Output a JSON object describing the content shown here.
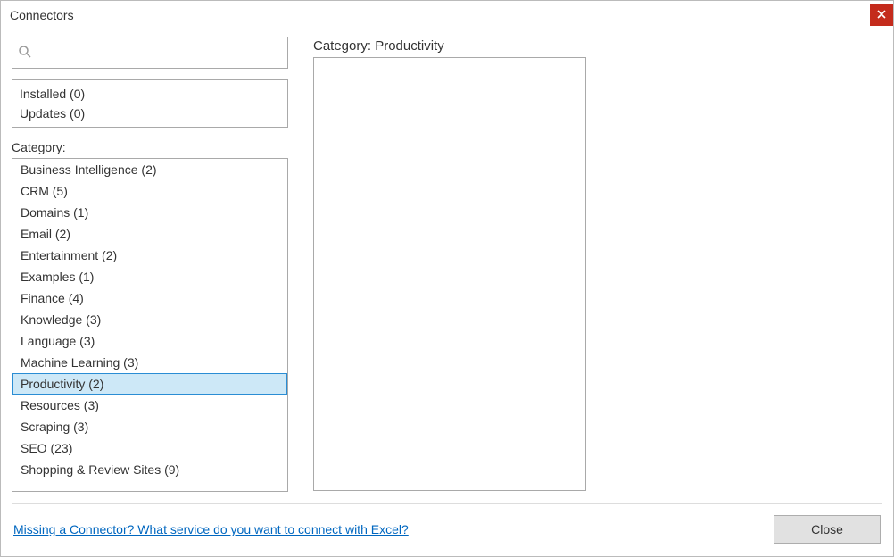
{
  "window": {
    "title": "Connectors"
  },
  "search": {
    "placeholder": ""
  },
  "status": {
    "installed_label": "Installed (0)",
    "updates_label": "Updates (0)"
  },
  "category_label": "Category:",
  "categories": [
    {
      "label": "Business Intelligence (2)",
      "selected": false
    },
    {
      "label": "CRM (5)",
      "selected": false
    },
    {
      "label": "Domains (1)",
      "selected": false
    },
    {
      "label": "Email (2)",
      "selected": false
    },
    {
      "label": "Entertainment (2)",
      "selected": false
    },
    {
      "label": "Examples (1)",
      "selected": false
    },
    {
      "label": "Finance (4)",
      "selected": false
    },
    {
      "label": "Knowledge (3)",
      "selected": false
    },
    {
      "label": "Language (3)",
      "selected": false
    },
    {
      "label": "Machine Learning (3)",
      "selected": false
    },
    {
      "label": "Productivity (2)",
      "selected": true
    },
    {
      "label": "Resources (3)",
      "selected": false
    },
    {
      "label": "Scraping (3)",
      "selected": false
    },
    {
      "label": "SEO (23)",
      "selected": false
    },
    {
      "label": "Shopping & Review Sites (9)",
      "selected": false
    }
  ],
  "detail": {
    "header": "Category: Productivity"
  },
  "footer": {
    "link_text": "Missing a Connector? What service do you want to connect with Excel?",
    "close_label": "Close"
  }
}
